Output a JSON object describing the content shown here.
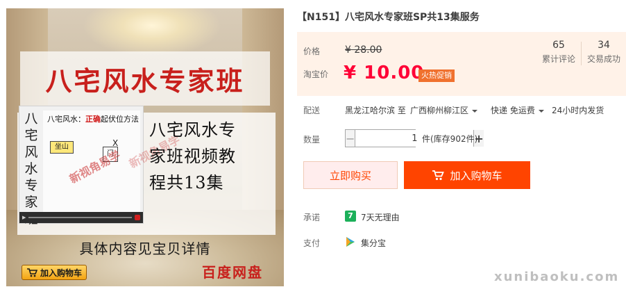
{
  "image": {
    "banner_title": "八宅风水专家班",
    "vertical_title": "八宅风水专家班",
    "video_caption_prefix": "八宅风水：",
    "video_caption_highlight": "正确",
    "video_caption_suffix": "起伏位方法",
    "box_label": "坐山",
    "door_label": "门",
    "mark_x": "X",
    "watermark": "新视角易学",
    "big_text": [
      "八宅风水专",
      "家班视频教",
      "程共13集"
    ],
    "detail_note": "具体内容见宝贝详情",
    "cart_badge": "加入购物车",
    "cloud_label": "百度网盘"
  },
  "product": {
    "title": "【N151】八宅风水专家班SP共13集服务"
  },
  "price": {
    "label": "价格",
    "original": "¥ 28.00",
    "promo_label": "淘宝价",
    "promo": "¥ 10.00",
    "promo_tag": "火热促销",
    "stats": [
      {
        "value": "65",
        "label": "累计评论"
      },
      {
        "value": "34",
        "label": "交易成功"
      }
    ]
  },
  "shipping": {
    "label": "配送",
    "from": "黑龙江哈尔滨 至",
    "to": "广西柳州柳江区",
    "method": "快递 免运费",
    "time": "24小时内发货"
  },
  "quantity": {
    "label": "数量",
    "minus": "−",
    "value": "1",
    "plus": "+",
    "stock": "件(库存902件)"
  },
  "actions": {
    "buy_now": "立即购买",
    "add_cart": "加入购物车"
  },
  "promise": {
    "label": "承诺",
    "text": "7天无理由",
    "icon_char": "7"
  },
  "payment": {
    "label": "支付",
    "text": "集分宝"
  },
  "site_watermark": "xunibaoku.com",
  "colors": {
    "price_red": "#ff0036",
    "cart_orange": "#ff4400",
    "price_panel_bg": "#fff2e8",
    "promo_tag": "#f0712e",
    "promise_green": "#1cb05a"
  }
}
